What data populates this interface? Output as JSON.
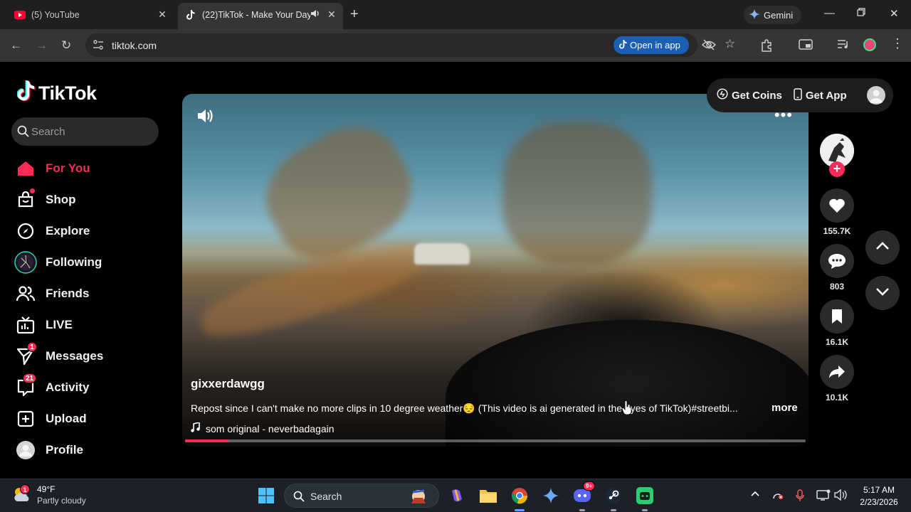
{
  "browser": {
    "tabs": [
      {
        "title": "(5) YouTube",
        "active": false
      },
      {
        "title": "(22)TikTok - Make Your Day",
        "active": true
      }
    ],
    "gemini_label": "Gemini",
    "url": "tiktok.com",
    "open_in_app_label": "Open in app"
  },
  "tiktok": {
    "logo_text": "TikTok",
    "search_placeholder": "Search",
    "menu": [
      {
        "label": "For You",
        "icon": "home-icon",
        "active": true
      },
      {
        "label": "Shop",
        "icon": "shop-icon"
      },
      {
        "label": "Explore",
        "icon": "compass-icon"
      },
      {
        "label": "Following",
        "icon": "following-avatar"
      },
      {
        "label": "Friends",
        "icon": "friends-icon"
      },
      {
        "label": "LIVE",
        "icon": "live-icon"
      },
      {
        "label": "Messages",
        "icon": "messages-icon",
        "badge": "1"
      },
      {
        "label": "Activity",
        "icon": "activity-icon",
        "badge": "21"
      },
      {
        "label": "Upload",
        "icon": "upload-icon"
      },
      {
        "label": "Profile",
        "icon": "profile-icon"
      }
    ],
    "header": {
      "get_coins": "Get Coins",
      "get_app": "Get App"
    },
    "video": {
      "author": "gixxerdawgg",
      "caption": "Repost since I can't make no more clips in 10 degree weather😔 (This video is ai generated in the eyes of TikTok)#streetbi...",
      "more_label": "more",
      "music": "som original - neverbadagain",
      "progress": 0.07
    },
    "actions": {
      "likes": "155.7K",
      "comments": "803",
      "saves": "16.1K",
      "shares": "10.1K"
    }
  },
  "taskbar": {
    "weather_temp": "49°F",
    "weather_condition": "Partly cloudy",
    "weather_badge": "1",
    "search_label": "Search",
    "discord_badge": "9+",
    "time": "5:17 AM",
    "date": "2/23/2026"
  },
  "colors": {
    "accent": "#fe2c55",
    "open_in_app_bg": "#1a5fb4"
  }
}
